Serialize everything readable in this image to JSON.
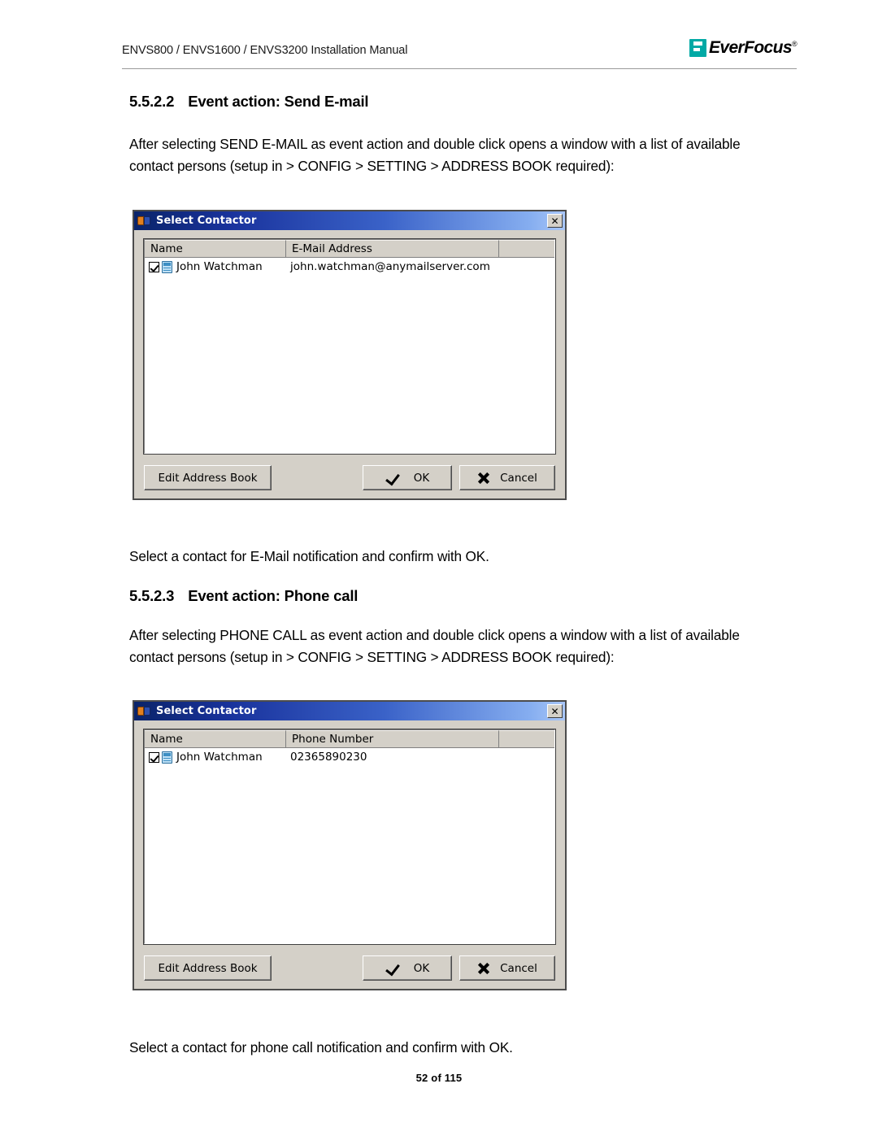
{
  "header": {
    "manual_title": "ENVS800 / ENVS1600 / ENVS3200 Installation Manual",
    "logo_text": "EverFocus",
    "logo_reg": "®",
    "logo_accent_color": "#00a9a5"
  },
  "sections": [
    {
      "number": "5.5.2.2",
      "title": "Event action: Send E-mail",
      "paragraph": "After selecting SEND E-MAIL as event action and double click opens a window with a list of available contact persons (setup in > CONFIG > SETTING > ADDRESS BOOK required):",
      "caption": "Select a contact for E-Mail notification and confirm with OK."
    },
    {
      "number": "5.5.2.3",
      "title": "Event action: Phone call",
      "paragraph": "After selecting PHONE CALL  as event action and double click opens a window with a list of available contact persons (setup in > CONFIG > SETTING > ADDRESS BOOK required):",
      "caption": "Select a contact for phone call notification and confirm with OK."
    }
  ],
  "dialogs": [
    {
      "title": "Select Contactor",
      "title_icon": "contact-book-icon",
      "close_label": "✕",
      "columns": [
        "Name",
        "E-Mail Address",
        ""
      ],
      "rows": [
        {
          "checked": true,
          "name": "John Watchman",
          "value": "john.watchman@anymailserver.com"
        }
      ],
      "buttons": {
        "edit": "Edit Address Book",
        "ok": "OK",
        "cancel": "Cancel"
      }
    },
    {
      "title": "Select Contactor",
      "title_icon": "contact-book-icon",
      "close_label": "✕",
      "columns": [
        "Name",
        "Phone Number",
        ""
      ],
      "rows": [
        {
          "checked": true,
          "name": "John Watchman",
          "value": "02365890230"
        }
      ],
      "buttons": {
        "edit": "Edit Address Book",
        "ok": "OK",
        "cancel": "Cancel"
      }
    }
  ],
  "footer": {
    "page_label": "52 of 115"
  }
}
